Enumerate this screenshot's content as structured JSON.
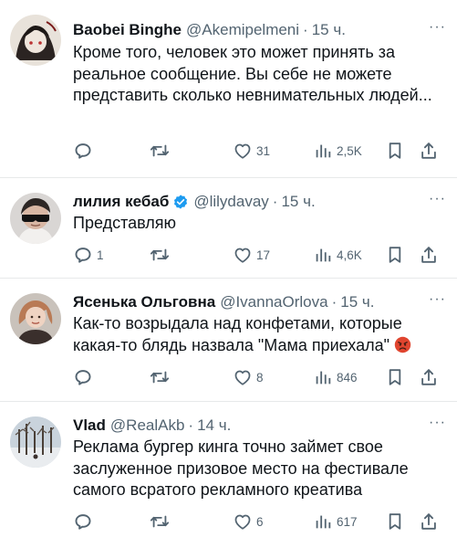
{
  "tweets": [
    {
      "name": "Baobei Binghe",
      "handle": "@Akemipelmeni",
      "dot": "·",
      "time": "15 ч.",
      "text": "Кроме того, человек это может принять за реальное сообщение. Вы себе не можете представить сколько невнимательных людей...",
      "replies": "",
      "reposts": "",
      "likes": "31",
      "views": "2,5K",
      "verified": false,
      "emoji": ""
    },
    {
      "name": "лилия кебаб",
      "handle": "@lilydavay",
      "dot": "·",
      "time": "15 ч.",
      "text": "Представляю",
      "replies": "1",
      "reposts": "",
      "likes": "17",
      "views": "4,6K",
      "verified": true,
      "emoji": ""
    },
    {
      "name": "Ясенька Ольговна",
      "handle": "@IvannaOrlova",
      "dot": "·",
      "time": "15 ч.",
      "text": "Как-то возрыдала над конфетами, которые какая-то блядь назвала \"Мама приехала\"",
      "replies": "",
      "reposts": "",
      "likes": "8",
      "views": "846",
      "verified": false,
      "emoji": "angry-face"
    },
    {
      "name": "Vlad",
      "handle": "@RealAkb",
      "dot": "·",
      "time": "14 ч.",
      "text": "Реклама бургер кинга точно займет свое заслуженное призовое место на фестивале самого всратого рекламного креатива",
      "replies": "",
      "reposts": "",
      "likes": "6",
      "views": "617",
      "verified": false,
      "emoji": ""
    }
  ],
  "more_label": "···",
  "colors": {
    "text": "#0f1419",
    "secondary": "#536471",
    "divider": "#e7e9ea",
    "verified": "#1d9bf0"
  },
  "icons": {
    "reply": "reply-icon",
    "repost": "repost-icon",
    "like": "like-icon",
    "views": "views-icon",
    "bookmark": "bookmark-icon",
    "share": "share-icon"
  }
}
